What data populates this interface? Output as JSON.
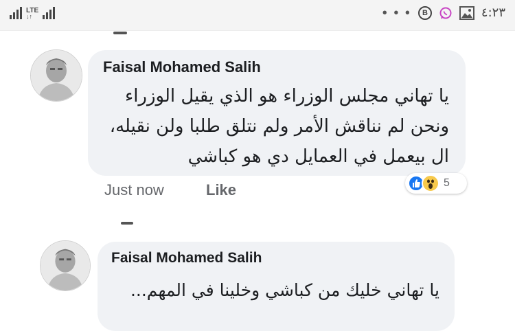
{
  "status_bar": {
    "network": "LTE",
    "overflow": "• • •",
    "b_icon": "B",
    "time": "٤:٢٣"
  },
  "comments": [
    {
      "author": "Faisal Mohamed Salih",
      "lines": [
        "يا تهاني مجلس الوزراء هو الذي يقيل الوزراء",
        "ونحن لم نناقش الأمر ولم نتلق طلبا ولن نقيله،",
        "ال بيعمل في العمايل دي هو كباشي"
      ],
      "timestamp": "Just now",
      "like_label": "Like",
      "reaction_count": "5",
      "reactions": [
        "like",
        "wow"
      ]
    },
    {
      "author": "Faisal Mohamed Salih",
      "lines": [
        "يا تهاني خليك من كباشي وخلينا في المهم..."
      ]
    }
  ],
  "colors": {
    "bubble": "#f0f2f5",
    "like_blue": "#1877f2",
    "wow_yellow": "#f7c94b",
    "meta_gray": "#65676b"
  }
}
